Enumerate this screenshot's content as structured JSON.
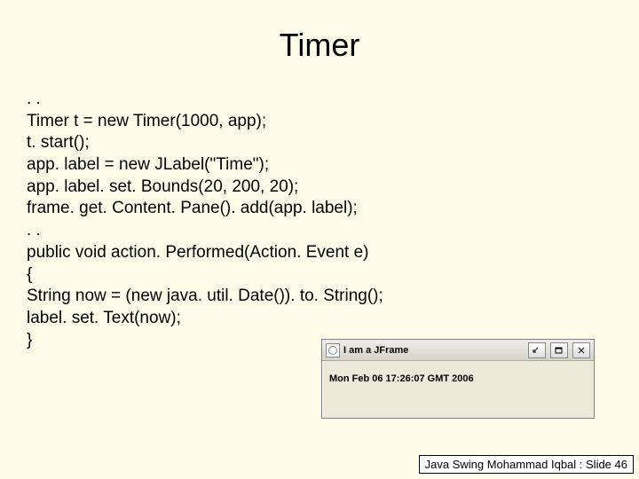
{
  "title": "Timer",
  "code": {
    "l0": ". .",
    "l1": "Timer t = new Timer(1000, app);",
    "l2": "t. start();",
    "l3": "app. label = new JLabel(\"Time\");",
    "l4": "app. label. set. Bounds(20, 200, 20);",
    "l5": "frame. get. Content. Pane(). add(app. label);",
    "l6": ". .",
    "l7": "public void action. Performed(Action. Event e)",
    "l8": "{",
    "l9": "String now = (new java. util. Date()). to. String();",
    "l10": "label. set. Text(now);",
    "l11": "}"
  },
  "jframe": {
    "title": "I am a JFrame",
    "body": "Mon Feb 06 17:26:07 GMT 2006"
  },
  "footer": "Java Swing Mohammad Iqbal : Slide 46"
}
